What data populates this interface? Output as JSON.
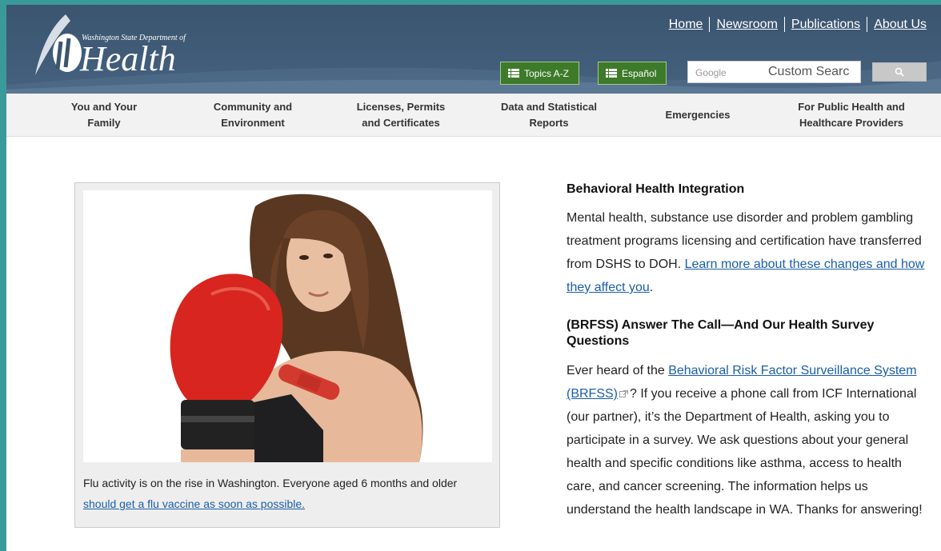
{
  "logo": {
    "small_text": "Washington State Department of",
    "big_text": "Health"
  },
  "toplinks": [
    "Home",
    "Newsroom",
    "Publications",
    "About Us"
  ],
  "buttons": {
    "topics": "Topics A-Z",
    "espanol": "Español"
  },
  "search": {
    "brand": "Google",
    "value": "Custom Searc"
  },
  "nav": [
    {
      "line1": "You and Your",
      "line2": "Family"
    },
    {
      "line1": "Community and",
      "line2": "Environment"
    },
    {
      "line1": "Licenses, Permits",
      "line2": "and Certificates"
    },
    {
      "line1": "Data and Statistical",
      "line2": "Reports"
    },
    {
      "line1": "Emergencies",
      "line2": ""
    },
    {
      "line1": "For Public Health and",
      "line2": "Healthcare Providers"
    }
  ],
  "feature": {
    "caption_text": "Flu activity is on the rise in Washington. Everyone aged 6 months and older ",
    "caption_link": "should get a flu vaccine as soon as possible."
  },
  "articles": {
    "bhi": {
      "title": "Behavioral Health Integration",
      "text": "Mental health, substance use disorder and problem gambling treatment programs licensing and certification have transferred from DSHS to DOH. ",
      "link": "Learn more about these changes and how they affect you",
      "end": "."
    },
    "brfss": {
      "title": "(BRFSS) Answer The Call—And Our Health Survey Questions",
      "text_before": "Ever heard of the ",
      "link": "Behavioral Risk Factor Surveillance System (BRFSS)",
      "text_after": "? If you receive a phone call from ICF International (our partner), it’s the Department of Health, asking you to participate in a survey. We ask questions about your general health and specific conditions like asthma, access to health care, and cancer screening. The information helps us understand the health landscape in WA. Thanks for answering!"
    }
  },
  "colors": {
    "header": "#3b556f",
    "green_button": "#3d7a2a",
    "link": "#1a5ea8",
    "frame": "#3a9a9a"
  }
}
